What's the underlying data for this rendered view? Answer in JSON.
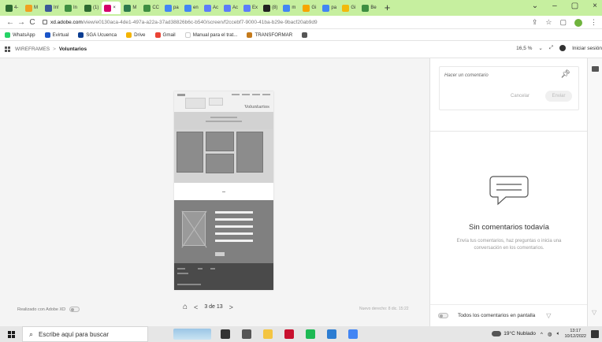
{
  "browser": {
    "tabs": [
      {
        "label": "4-",
        "color": "#2d6a31"
      },
      {
        "label": "M",
        "color": "#f0a020"
      },
      {
        "label": "In!",
        "color": "#3b5998"
      },
      {
        "label": "In",
        "color": "#3e8e41"
      },
      {
        "label": "(1)",
        "color": "#2d6a31"
      },
      {
        "label": "×",
        "color": "#d4006b",
        "active": true
      },
      {
        "label": "M",
        "color": "#2d7a4d"
      },
      {
        "label": "CC",
        "color": "#3e8e41"
      },
      {
        "label": "pa",
        "color": "#4285f4"
      },
      {
        "label": "en",
        "color": "#4285f4"
      },
      {
        "label": "Ac",
        "color": "#5c7cfa"
      },
      {
        "label": "Ac",
        "color": "#5c7cfa"
      },
      {
        "label": "Ex",
        "color": "#5c7cfa"
      },
      {
        "label": "(8)",
        "color": "#222222"
      },
      {
        "label": "m",
        "color": "#4285f4"
      },
      {
        "label": "Gi",
        "color": "#f6a500"
      },
      {
        "label": "pa",
        "color": "#4285f4"
      },
      {
        "label": "Gi",
        "color": "#f2b90c"
      },
      {
        "label": "Be",
        "color": "#3e8e41"
      }
    ],
    "new_tab": "+",
    "window_controls": {
      "chevron": "⌄",
      "minimize": "–",
      "restore": "▢",
      "close": "×"
    },
    "nav": {
      "back": "←",
      "forward": "→",
      "reload": "C"
    },
    "url_host": "xd.adobe.com",
    "url_rest": "/view/e0130aca-4de1-497a-a22a-37ad38826b6c-b540/screen/f2ccebf7-9000-41ba-b29e-9bacf20ab9d9",
    "addr_icons": {
      "share": "⇪",
      "star": "☆",
      "sidepanel": "▢"
    }
  },
  "bookmarks": [
    {
      "label": "WhatsApp",
      "color": "#25d366"
    },
    {
      "label": "Evirtual",
      "color": "#1a55c8"
    },
    {
      "label": "SGA Ucuenca",
      "color": "#0b3d91"
    },
    {
      "label": "Drive",
      "color": "#f4b400"
    },
    {
      "label": "Gmail",
      "color": "#ea4335"
    },
    {
      "label": "Manual para el trat...",
      "color": "#ffffff"
    },
    {
      "label": "TRANSFORMAR",
      "color": "#c47a1b"
    },
    {
      "label": "",
      "color": "#555555"
    }
  ],
  "xd": {
    "crumb_root": "WIREFRAMES",
    "crumb_sep": ">",
    "crumb_current": "Voluntarios",
    "zoom": "16,5 %",
    "signin": "Iniciar sesión",
    "artboard_title": "Voluntarios",
    "made_with": "Realizado con Adobe XD",
    "page_counter": "3 de 13",
    "prev": "<",
    "next": ">",
    "edited": "Nuevo derecho: 8 dic. 15:22"
  },
  "comments": {
    "placeholder": "Hacer un comentario",
    "cancel": "Cancelar",
    "send": "Enviar",
    "empty_title": "Sin comentarios todavía",
    "empty_hint": "Envía tus comentarios, haz preguntas o inicia una conversación en los comentarios.",
    "all_on_screen": "Todos los comentarios en pantalla"
  },
  "taskbar": {
    "search_placeholder": "Escribe aquí para buscar",
    "weather": "19°C  Nublado",
    "time": "13:17",
    "date": "10/12/2022",
    "app_colors": [
      "#333333",
      "#555555",
      "#f4c542",
      "#c8102e",
      "#1db954",
      "#2d7dd2",
      "#4285f4"
    ]
  }
}
